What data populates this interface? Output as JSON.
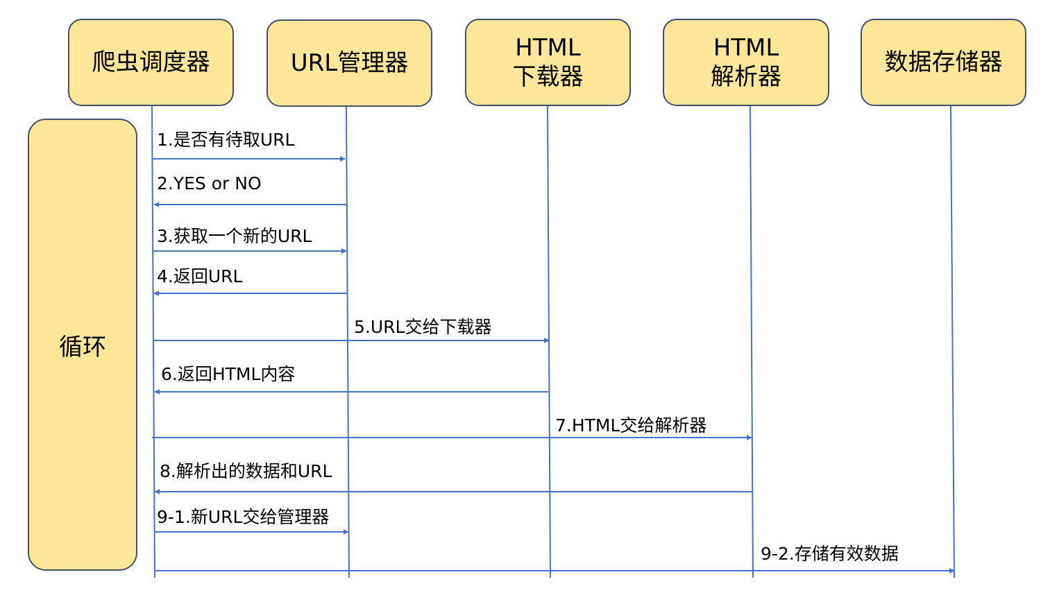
{
  "actors": [
    {
      "id": "scheduler",
      "label": "爬虫调度器"
    },
    {
      "id": "url_manager",
      "label": "URL管理器"
    },
    {
      "id": "downloader",
      "label": "HTML\n下载器"
    },
    {
      "id": "parser",
      "label": "HTML\n解析器"
    },
    {
      "id": "storage",
      "label": "数据存储器"
    }
  ],
  "loop": {
    "label": "循环"
  },
  "messages": [
    {
      "label": "1.是否有待取URL",
      "from": "scheduler",
      "to": "url_manager"
    },
    {
      "label": "2.YES or NO",
      "from": "url_manager",
      "to": "scheduler"
    },
    {
      "label": "3.获取一个新的URL",
      "from": "scheduler",
      "to": "url_manager"
    },
    {
      "label": "4.返回URL",
      "from": "url_manager",
      "to": "scheduler"
    },
    {
      "label": "5.URL交给下载器",
      "from": "scheduler",
      "to": "downloader"
    },
    {
      "label": "6.返回HTML内容",
      "from": "downloader",
      "to": "scheduler"
    },
    {
      "label": "7.HTML交给解析器",
      "from": "scheduler",
      "to": "parser"
    },
    {
      "label": "8.解析出的数据和URL",
      "from": "parser",
      "to": "scheduler"
    },
    {
      "label": "9-1.新URL交给管理器",
      "from": "scheduler",
      "to": "url_manager"
    },
    {
      "label": "9-2.存储有效数据",
      "from": "scheduler",
      "to": "storage"
    }
  ],
  "colors": {
    "box_fill": "#ffe699",
    "box_border": "#41506b",
    "line": "#4472c4"
  }
}
